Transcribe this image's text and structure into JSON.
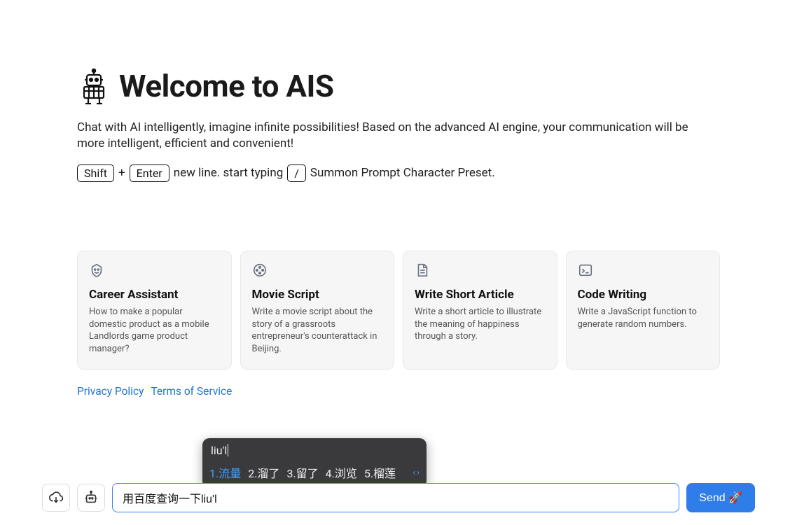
{
  "header": {
    "title": "Welcome to AIS",
    "subtitle": "Chat with AI intelligently, imagine infinite possibilities! Based on the advanced AI engine, your communication will be more intelligent, efficient and convenient!",
    "hint_shift": "Shift",
    "hint_plus": "+",
    "hint_enter": "Enter",
    "hint_newline": "new line. start typing",
    "hint_slash": "/",
    "hint_summon": "Summon Prompt Character Preset."
  },
  "cards": [
    {
      "icon": "face-icon",
      "title": "Career Assistant",
      "desc": "How to make a popular domestic product as a mobile Landlords game product manager?"
    },
    {
      "icon": "film-icon",
      "title": "Movie Script",
      "desc": "Write a movie script about the story of a grassroots entrepreneur's counterattack in Beijing."
    },
    {
      "icon": "document-icon",
      "title": "Write Short Article",
      "desc": "Write a short article to illustrate the meaning of happiness through a story."
    },
    {
      "icon": "code-icon",
      "title": "Code Writing",
      "desc": "Write a JavaScript function to generate random numbers."
    }
  ],
  "links": {
    "privacy": "Privacy Policy",
    "terms": "Terms of Service"
  },
  "ime": {
    "input": "liu'l",
    "candidates": [
      "1.流量",
      "2.溜了",
      "3.留了",
      "4.浏览",
      "5.榴莲"
    ]
  },
  "input_bar": {
    "value": "用百度查询一下liu'l",
    "send_label": "Send 🚀"
  }
}
